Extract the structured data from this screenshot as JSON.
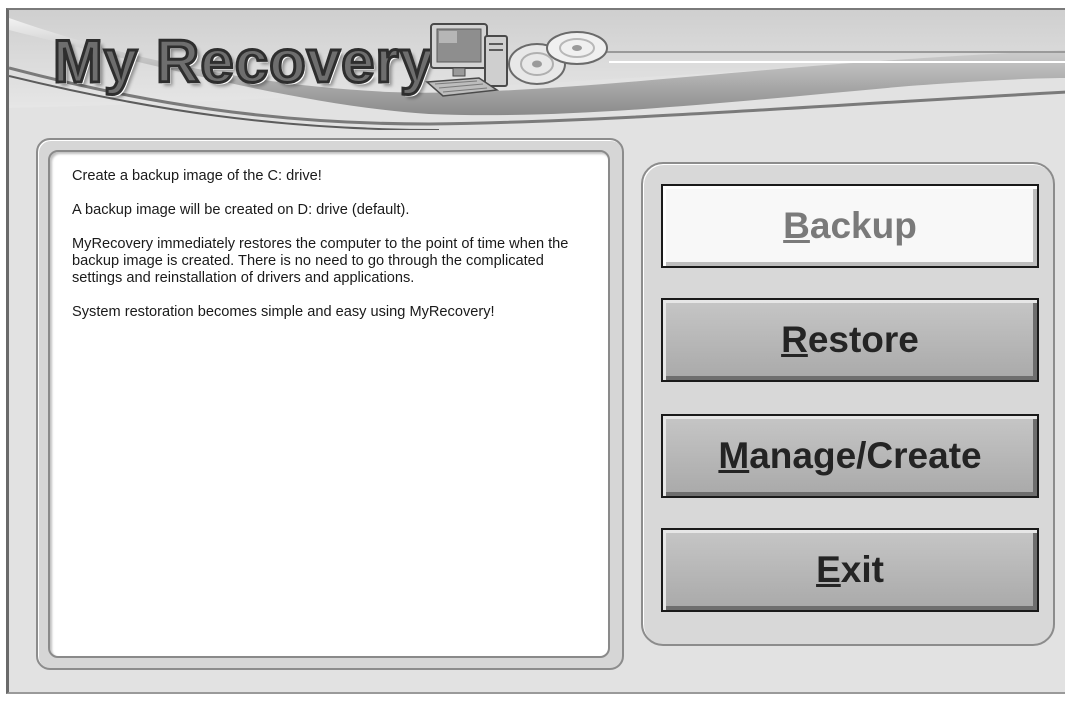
{
  "app": {
    "title": "My Recovery"
  },
  "info": {
    "paragraphs": [
      "Create a backup image of the C: drive!",
      "A backup image will be created on D: drive (default).",
      "MyRecovery immediately restores the computer to the point of time when the backup image is created.  There is no need to go through the complicated settings and reinstallation of drivers and applications.",
      "System restoration becomes simple and easy using MyRecovery!"
    ]
  },
  "buttons": {
    "backup": {
      "mnemonic": "B",
      "rest": "ackup"
    },
    "restore": {
      "mnemonic": "R",
      "rest": "estore"
    },
    "manage": {
      "mnemonic": "M",
      "rest": "anage/Create"
    },
    "exit": {
      "mnemonic": "E",
      "rest": "xit"
    }
  },
  "icons": [
    "computer-icon",
    "disc-icon"
  ],
  "colors": {
    "window_bg": "#e2e2e2",
    "panel_bg": "#ffffff",
    "button_primary_bg": "#f8f8f8",
    "button_bg": "#b8b8b8",
    "text": "#1a1a1a"
  }
}
